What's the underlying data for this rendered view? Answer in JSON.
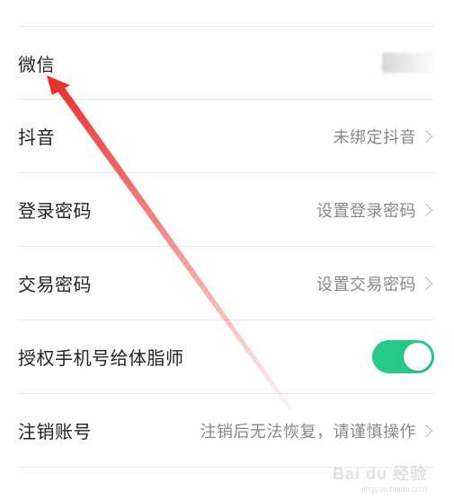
{
  "settings": {
    "rows": [
      {
        "label": "微信",
        "value": "",
        "masked": true
      },
      {
        "label": "抖音",
        "value": "未绑定抖音"
      },
      {
        "label": "登录密码",
        "value": "设置登录密码"
      },
      {
        "label": "交易密码",
        "value": "设置交易密码"
      },
      {
        "label": "授权手机号给体脂师",
        "toggle_on": true
      },
      {
        "label": "注销账号",
        "value": "注销后无法恢复，请谨慎操作"
      }
    ]
  },
  "annotation": {
    "arrow_color": "#e8322e"
  },
  "watermark": {
    "main": "Bai du 经验",
    "sub": "jingyan.baidu.com"
  },
  "colors": {
    "toggle_on": "#27c98a",
    "label_text": "#222222",
    "value_text": "#888888",
    "divider": "#ececec"
  }
}
